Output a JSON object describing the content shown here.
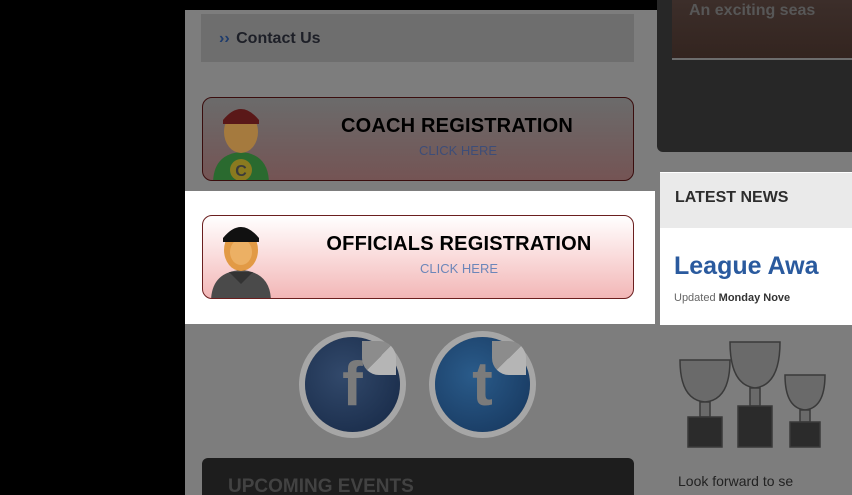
{
  "sidebar": {
    "contact_prefix": "››",
    "contact_label": "Contact Us",
    "coach": {
      "title": "COACH REGISTRATION",
      "click": "CLICK HERE",
      "badge_letter": "C"
    },
    "officials": {
      "title": "OFFICIALS REGISTRATION",
      "click": "CLICK HERE"
    },
    "social": [
      {
        "name": "facebook",
        "glyph": "f",
        "icon": "facebook-icon"
      },
      {
        "name": "twitter",
        "glyph": "t",
        "icon": "twitter-icon"
      }
    ],
    "events_title": "UPCOMING EVENTS"
  },
  "feature": {
    "caption": "An exciting seas"
  },
  "news": {
    "section_title": "LATEST NEWS",
    "headline": "League Awa",
    "updated_label": "Updated",
    "updated_value": "Monday Nove",
    "teaser": "Look forward to se"
  },
  "colors": {
    "headline_blue": "#2a5a9e",
    "registration_border": "#6b1f1f",
    "coach_shirt": "#2f8c35",
    "cap_red": "#9b2323"
  }
}
